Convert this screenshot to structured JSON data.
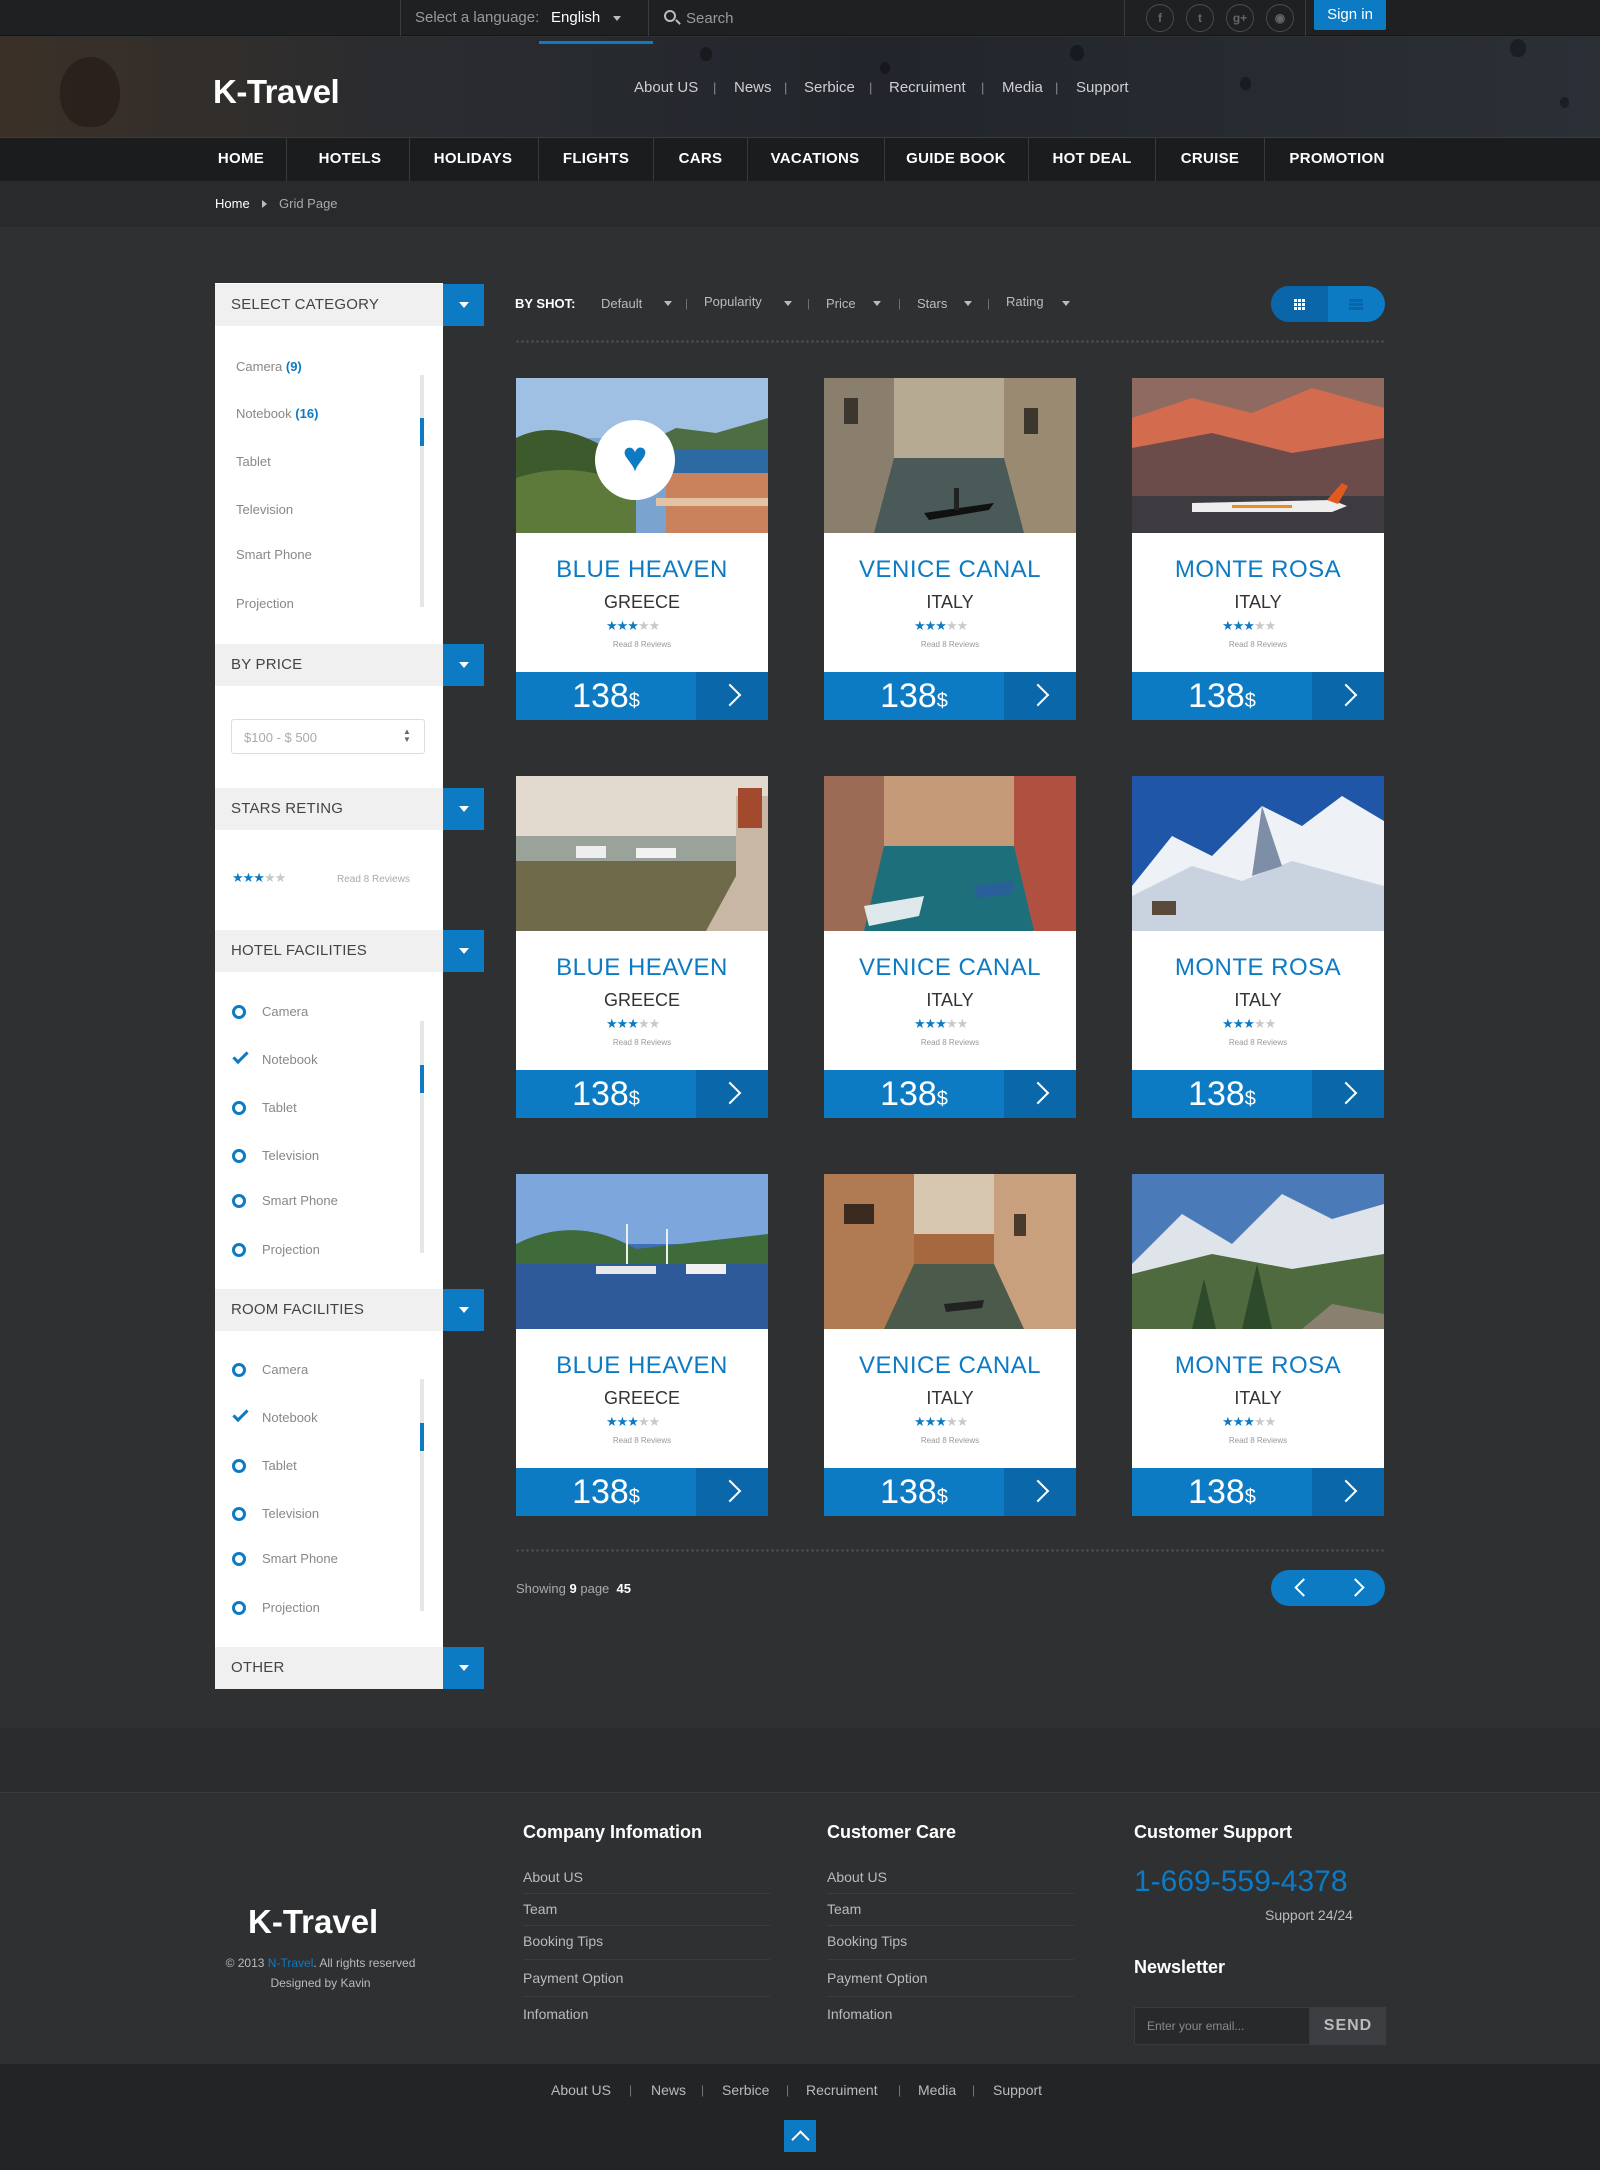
{
  "topbar": {
    "language_label": "Select a language:",
    "language_value": "English",
    "search_placeholder": "Search",
    "social_icons": [
      "facebook-icon",
      "twitter-icon",
      "google-plus-icon",
      "rss-icon"
    ],
    "signin_label": "Sign in"
  },
  "header": {
    "logo": "K-Travel",
    "links": [
      "About US",
      "News",
      "Serbice",
      "Recruiment",
      "Media",
      "Support"
    ]
  },
  "nav": {
    "items": [
      "HOME",
      "HOTELS",
      "HOLIDAYS",
      "FLIGHTS",
      "CARS",
      "VACATIONS",
      "GUIDE BOOK",
      "HOT DEAL",
      "CRUISE",
      "PROMOTION"
    ],
    "active": "FLIGHTS"
  },
  "breadcrumb": {
    "home": "Home",
    "current": "Grid Page"
  },
  "sidebar": {
    "category": {
      "title": "SELECT CATEGORY",
      "items": [
        {
          "label": "Camera",
          "count": "(9)"
        },
        {
          "label": "Notebook",
          "count": "(16)"
        },
        {
          "label": "Tablet",
          "count": ""
        },
        {
          "label": "Television",
          "count": ""
        },
        {
          "label": "Smart Phone",
          "count": ""
        },
        {
          "label": "Projection",
          "count": ""
        }
      ]
    },
    "price": {
      "title": "BY PRICE",
      "value": "$100 - $ 500"
    },
    "stars": {
      "title": "STARS RETING",
      "rating": 3,
      "max": 5,
      "reviews": "Read 8 Reviews"
    },
    "hotel_facilities": {
      "title": "HOTEL FACILITIES",
      "items": [
        {
          "label": "Camera",
          "checked": false
        },
        {
          "label": "Notebook",
          "checked": true
        },
        {
          "label": "Tablet",
          "checked": false
        },
        {
          "label": "Television",
          "checked": false
        },
        {
          "label": "Smart Phone",
          "checked": false
        },
        {
          "label": "Projection",
          "checked": false
        }
      ]
    },
    "room_facilities": {
      "title": "ROOM FACILITIES",
      "items": [
        {
          "label": "Camera",
          "checked": false
        },
        {
          "label": "Notebook",
          "checked": true
        },
        {
          "label": "Tablet",
          "checked": false
        },
        {
          "label": "Television",
          "checked": false
        },
        {
          "label": "Smart Phone",
          "checked": false
        },
        {
          "label": "Projection",
          "checked": false
        }
      ]
    },
    "other": {
      "title": "OTHER"
    }
  },
  "sortbar": {
    "label": "BY SHOT:",
    "options": [
      "Default",
      "Popularity",
      "Price",
      "Stars",
      "Rating"
    ],
    "view": "grid"
  },
  "cards": [
    {
      "title": "BLUE HEAVEN",
      "country": "GREECE",
      "rating": 3,
      "reviews": "Read 8 Reviews",
      "price": "138",
      "currency": "$",
      "favorite": true,
      "image": "coast-terrace"
    },
    {
      "title": "VENICE CANAL",
      "country": "ITALY",
      "rating": 3,
      "reviews": "Read 8 Reviews",
      "price": "138",
      "currency": "$",
      "favorite": false,
      "image": "canal-gondola"
    },
    {
      "title": "MONTE ROSA",
      "country": "ITALY",
      "rating": 3,
      "reviews": "Read 8 Reviews",
      "price": "138",
      "currency": "$",
      "favorite": false,
      "image": "sunset-mountain-plane"
    },
    {
      "title": "BLUE HEAVEN",
      "country": "GREECE",
      "rating": 3,
      "reviews": "Read 8 Reviews",
      "price": "138",
      "currency": "$",
      "favorite": false,
      "image": "coast-village"
    },
    {
      "title": "VENICE CANAL",
      "country": "ITALY",
      "rating": 3,
      "reviews": "Read 8 Reviews",
      "price": "138",
      "currency": "$",
      "favorite": false,
      "image": "canal-boats"
    },
    {
      "title": "MONTE ROSA",
      "country": "ITALY",
      "rating": 3,
      "reviews": "Read 8 Reviews",
      "price": "138",
      "currency": "$",
      "favorite": false,
      "image": "snow-peaks"
    },
    {
      "title": "BLUE HEAVEN",
      "country": "GREECE",
      "rating": 3,
      "reviews": "Read 8 Reviews",
      "price": "138",
      "currency": "$",
      "favorite": false,
      "image": "harbor-boats"
    },
    {
      "title": "VENICE CANAL",
      "country": "ITALY",
      "rating": 3,
      "reviews": "Read 8 Reviews",
      "price": "138",
      "currency": "$",
      "favorite": false,
      "image": "canal-houses"
    },
    {
      "title": "MONTE ROSA",
      "country": "ITALY",
      "rating": 3,
      "reviews": "Read 8 Reviews",
      "price": "138",
      "currency": "$",
      "favorite": false,
      "image": "alpine-valley"
    }
  ],
  "pagination": {
    "showing_label": "Showing",
    "shown": "9",
    "page_label": "page",
    "total": "45"
  },
  "footer": {
    "logo": "K-Travel",
    "copyright_prefix": "© 2013",
    "copyright_link": "N-Travel",
    "copyright_suffix": ". All rights reserved",
    "designed_by": "Designed by Kavin",
    "company": {
      "title": "Company Infomation",
      "links": [
        "About US",
        "Team",
        "Booking Tips",
        "Payment Option",
        "Infomation"
      ]
    },
    "care": {
      "title": "Customer Care",
      "links": [
        "About US",
        "Team",
        "Booking Tips",
        "Payment Option",
        "Infomation"
      ]
    },
    "support": {
      "title": "Customer Support",
      "phone": "1-669-559-4378",
      "hours": "Support 24/24"
    },
    "newsletter": {
      "title": "Newsletter",
      "placeholder": "Enter your email...",
      "button": "SEND"
    },
    "bottom_links": [
      "About US",
      "News",
      "Serbice",
      "Recruiment",
      "Media",
      "Support"
    ]
  },
  "colors": {
    "accent": "#0d7ac4",
    "background": "#2f3032",
    "header_dark": "#1b1c1e"
  }
}
